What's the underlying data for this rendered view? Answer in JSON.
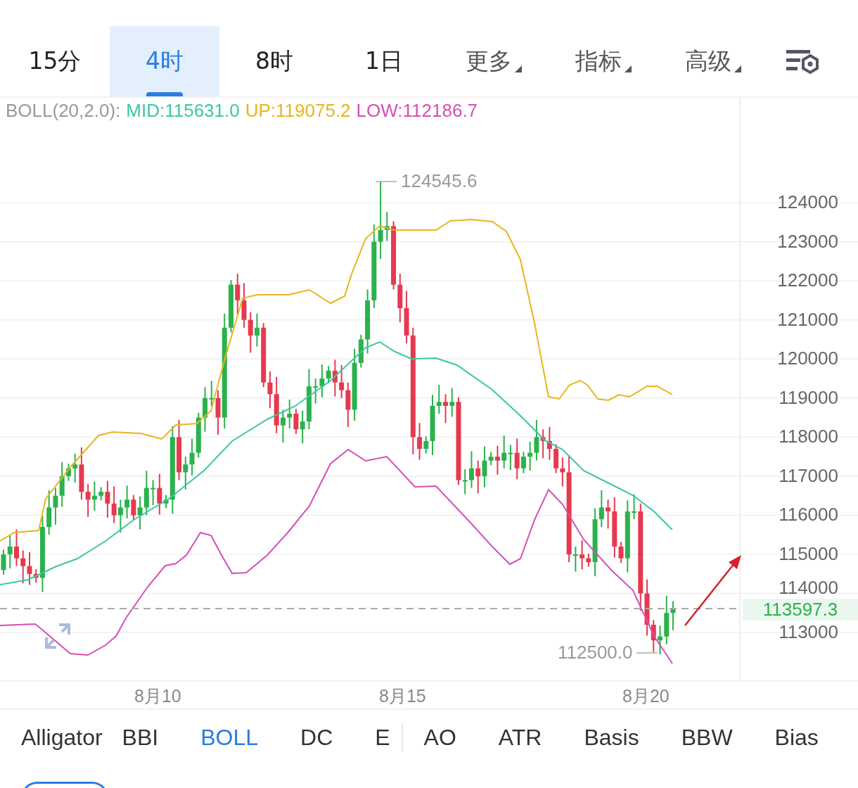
{
  "tabs": [
    {
      "label": "15分",
      "kind": "plain",
      "selected": false
    },
    {
      "label": "4时",
      "kind": "plain",
      "selected": true
    },
    {
      "label": "8时",
      "kind": "plain",
      "selected": false
    },
    {
      "label": "1日",
      "kind": "plain",
      "selected": false
    },
    {
      "label": "更多",
      "kind": "dropdown",
      "selected": false
    },
    {
      "label": "指标",
      "kind": "dropdown",
      "selected": false
    },
    {
      "label": "高级",
      "kind": "dropdown",
      "selected": false
    }
  ],
  "legend": {
    "label": "BOLL(20,2.0):",
    "values": [
      {
        "text": "MID:115631.0",
        "color": "#3cc7a4"
      },
      {
        "text": "UP:119075.2",
        "color": "#e8b51c"
      },
      {
        "text": "LOW:112186.7",
        "color": "#d64fb5"
      }
    ]
  },
  "chart": {
    "y_ticks": [
      "124000",
      "123000",
      "122000",
      "121000",
      "120000",
      "119000",
      "118000",
      "117000",
      "116000",
      "115000",
      "114000",
      "113000"
    ],
    "high_label": "124545.6",
    "low_label": "112500.0",
    "last_price": "113597.3",
    "dates": [
      "8月10",
      "8月15",
      "8月20"
    ]
  },
  "indicators": {
    "main": [
      {
        "label": "Alligator",
        "selected": false
      },
      {
        "label": "BBI",
        "selected": false
      },
      {
        "label": "BOLL",
        "selected": true
      },
      {
        "label": "DC",
        "selected": false
      },
      {
        "label": "E",
        "selected": false
      }
    ],
    "sub": [
      {
        "label": "AO",
        "selected": false
      },
      {
        "label": "ATR",
        "selected": false
      },
      {
        "label": "Basis",
        "selected": false
      },
      {
        "label": "BBW",
        "selected": false
      },
      {
        "label": "Bias",
        "selected": false
      }
    ]
  }
}
